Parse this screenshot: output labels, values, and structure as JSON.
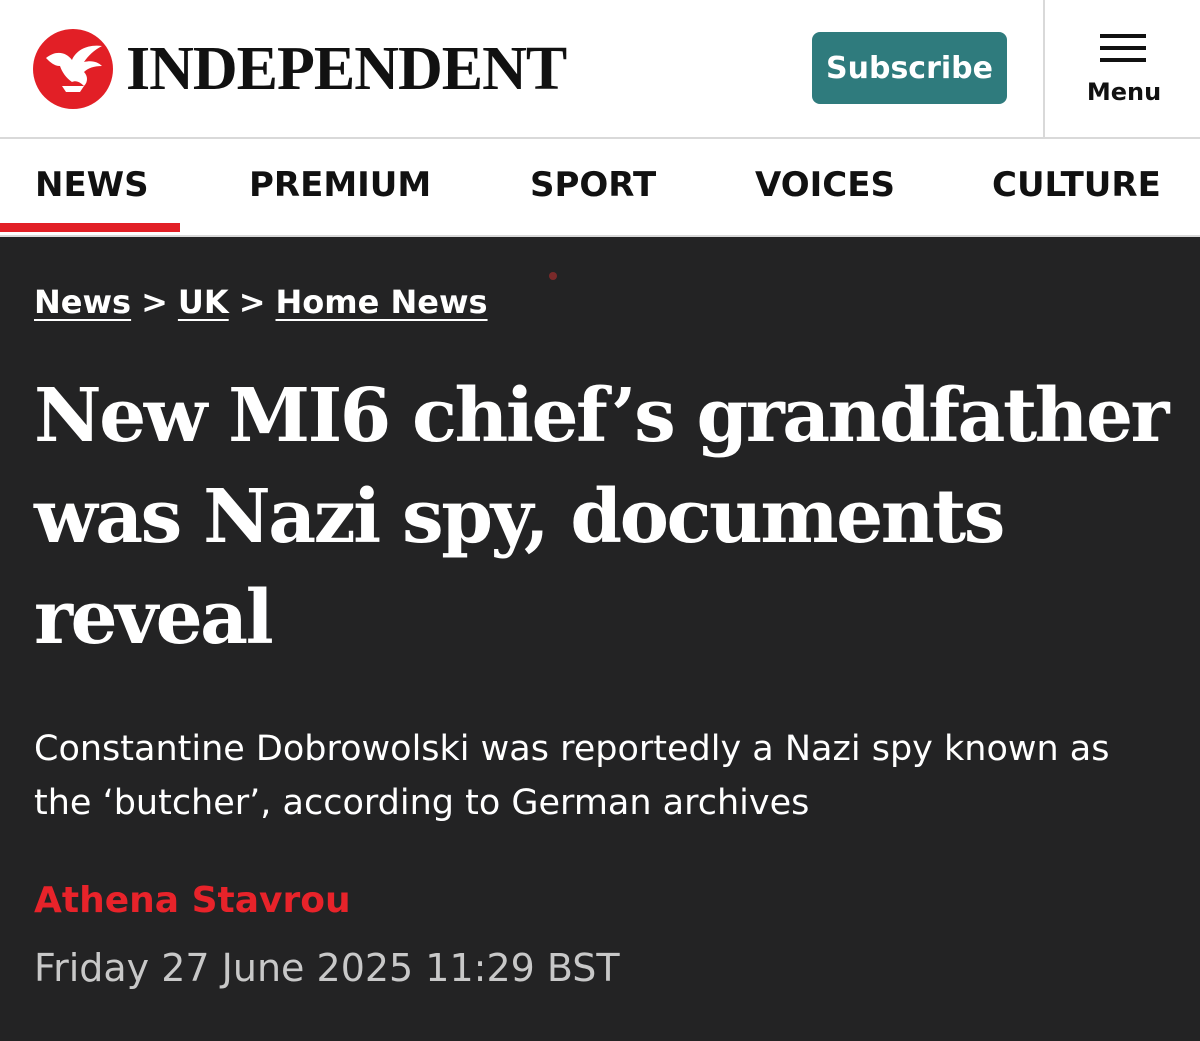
{
  "header": {
    "brand_name": "INDEPENDENT",
    "logo_icon": "eagle-icon",
    "brand_color": "#e21f26",
    "subscribe_label": "Subscribe",
    "subscribe_color": "#2f7b7d",
    "menu_label": "Menu",
    "menu_icon": "hamburger-icon"
  },
  "nav": {
    "items": [
      {
        "label": "NEWS",
        "active": true
      },
      {
        "label": "PREMIUM"
      },
      {
        "label": "SPORT"
      },
      {
        "label": "VOICES"
      },
      {
        "label": "CULTURE"
      }
    ],
    "active_color": "#e21f26"
  },
  "breadcrumb": {
    "items": [
      "News",
      "UK",
      "Home News"
    ],
    "separator": ">"
  },
  "article": {
    "headline": "New MI6 chief’s grandfather was Nazi spy, documents reveal",
    "standfirst": "Constantine Dobrowolski was reportedly a Nazi spy known as the ‘butcher’, according to German archives",
    "author": "Athena Stavrou",
    "author_color": "#e8232a",
    "date": "Friday 27 June 2025 11:29 BST"
  },
  "theme": {
    "background": "#232324",
    "text": "#ffffff"
  }
}
